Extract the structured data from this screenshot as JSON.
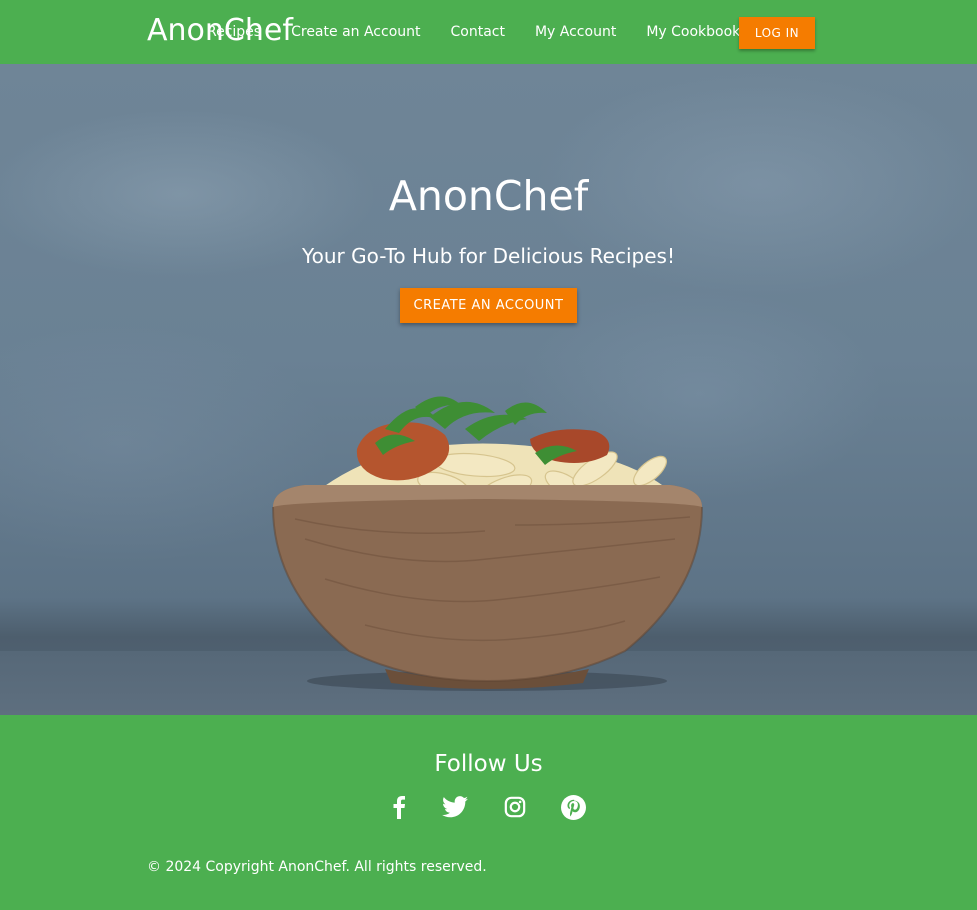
{
  "navbar": {
    "brand": "AnonChef",
    "links": [
      "Recipes",
      "Create an Account",
      "Contact",
      "My Account",
      "My Cookbook"
    ],
    "login_label": "LOG IN"
  },
  "hero": {
    "title": "AnonChef",
    "subtitle": "Your Go-To Hub for Delicious Recipes!",
    "cta_label": "CREATE AN ACCOUNT"
  },
  "footer": {
    "follow_title": "Follow Us",
    "social_icons": [
      "facebook-icon",
      "twitter-icon",
      "instagram-icon",
      "pinterest-icon"
    ],
    "copyright": "© 2024 Copyright AnonChef. All rights reserved."
  },
  "colors": {
    "primary_green": "#4caf50",
    "accent_orange": "#f57c00"
  }
}
